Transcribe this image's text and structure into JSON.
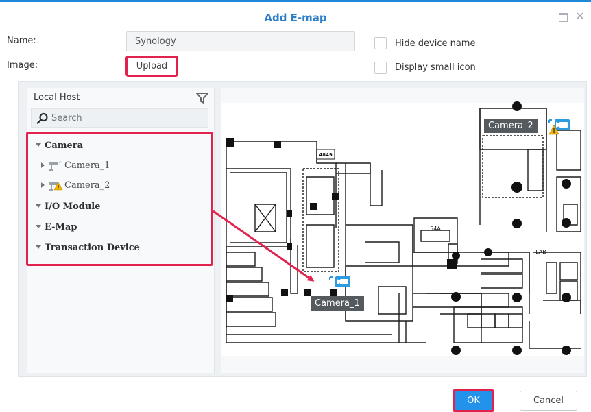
{
  "dialog": {
    "title": "Add E-map"
  },
  "form": {
    "name_label": "Name:",
    "name_value": "Synology",
    "image_label": "Image:",
    "upload_label": "Upload",
    "hide_device_name_label": "Hide device name",
    "display_small_icon_label": "Display small icon",
    "hide_device_name_checked": false,
    "display_small_icon_checked": false
  },
  "tree": {
    "host_label": "Local Host",
    "search_placeholder": "Search",
    "camera_label": "Camera",
    "camera_1_label": "Camera_1",
    "camera_2_label": "Camera_2",
    "io_module_label": "I/O Module",
    "emap_label": "E-Map",
    "transaction_device_label": "Transaction Device"
  },
  "map": {
    "camera_1_tag": "Camera_1",
    "camera_2_tag": "Camera_2",
    "room_label_4849": "4849",
    "room_label_54a": "54A",
    "room_label_lab": "LAB"
  },
  "footer": {
    "ok_label": "OK",
    "cancel_label": "Cancel"
  },
  "colors": {
    "accent": "#1e88d8",
    "title": "#2d7fc7",
    "highlight": "#e2214c",
    "ok_button": "#2392ea"
  }
}
